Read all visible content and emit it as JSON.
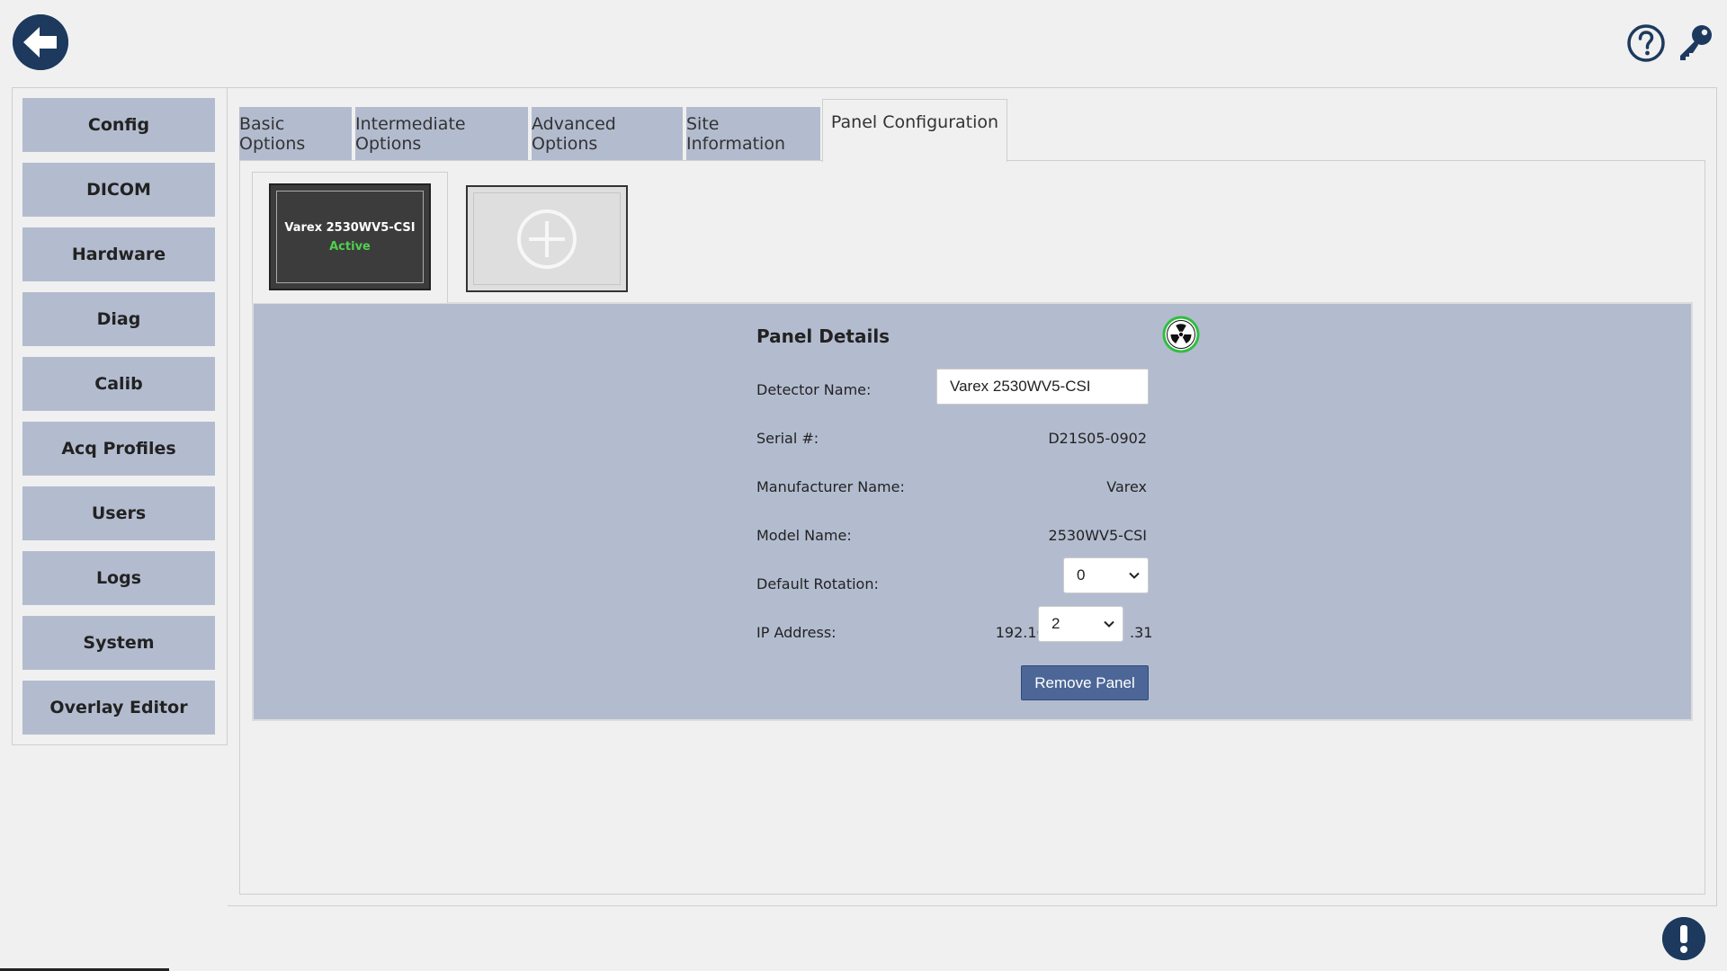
{
  "colors": {
    "nav_active": "#4c6797",
    "nav_inactive": "#b3bccf",
    "details_bg": "#b3bccf",
    "icon_navy": "#1d3a5e",
    "active_status": "#4fd04f",
    "radiation_ring": "#2fbf3f"
  },
  "header": {
    "back_icon": "arrow-left-circle-icon",
    "help_icon": "question-circle-icon",
    "key_icon": "key-icon"
  },
  "sidebar": {
    "items": [
      {
        "label": "Config",
        "active": true
      },
      {
        "label": "DICOM",
        "active": false
      },
      {
        "label": "Hardware",
        "active": false
      },
      {
        "label": "Diag",
        "active": false
      },
      {
        "label": "Calib",
        "active": false
      },
      {
        "label": "Acq Profiles",
        "active": false
      },
      {
        "label": "Users",
        "active": false
      },
      {
        "label": "Logs",
        "active": false
      },
      {
        "label": "System",
        "active": false
      },
      {
        "label": "Overlay Editor",
        "active": false
      }
    ]
  },
  "tabs": [
    {
      "label": "Basic Options",
      "active": false
    },
    {
      "label": "Intermediate Options",
      "active": false
    },
    {
      "label": "Advanced Options",
      "active": false
    },
    {
      "label": "Site Information",
      "active": false
    },
    {
      "label": "Panel Configuration",
      "active": true
    }
  ],
  "panels": {
    "cards": [
      {
        "name": "Varex 2530WV5-CSI",
        "status": "Active"
      }
    ],
    "add_icon": "plus-circle-icon"
  },
  "panel_details": {
    "title": "Panel Details",
    "status_icon": "radiation-icon",
    "detector_name_label": "Detector Name:",
    "detector_name_value": "Varex 2530WV5-CSI",
    "serial_label": "Serial #:",
    "serial_value": "D21S05-0902",
    "manufacturer_label": "Manufacturer Name:",
    "manufacturer_value": "Varex",
    "model_label": "Model Name:",
    "model_value": "2530WV5-CSI",
    "rotation_label": "Default Rotation:",
    "rotation_value": "0",
    "ip_label": "IP Address:",
    "ip_prefix": "192.168.",
    "ip_octet3": "2",
    "ip_suffix": ".31",
    "remove_button": "Remove Panel"
  },
  "footer": {
    "alert_icon": "exclamation-circle-icon"
  }
}
